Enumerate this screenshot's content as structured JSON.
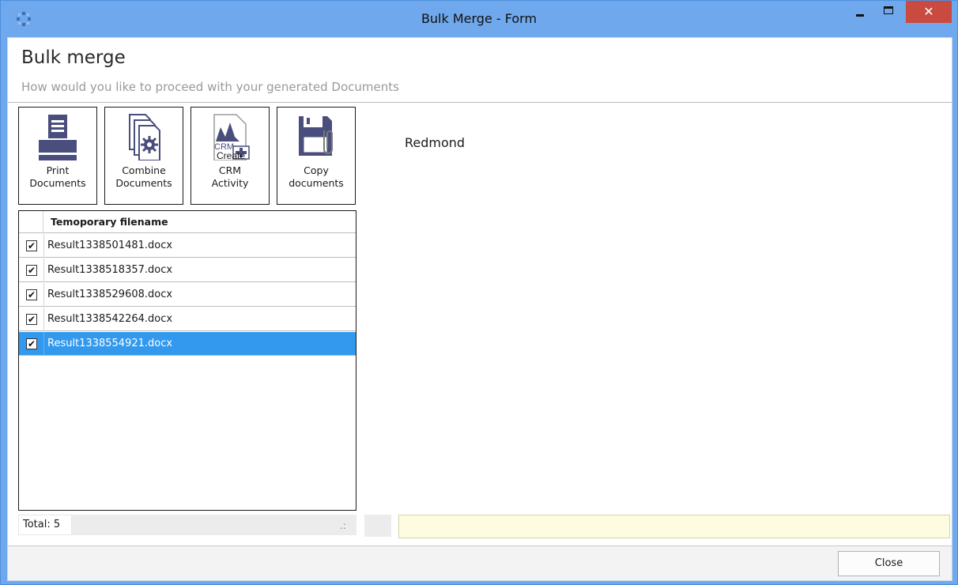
{
  "window": {
    "title": "Bulk Merge - Form",
    "close_glyph": "✕"
  },
  "header": {
    "title": "Bulk merge",
    "subtitle": "How would you like to proceed with your generated Documents"
  },
  "toolbar": [
    {
      "label": "Print\nDocuments",
      "icon": "printer-icon"
    },
    {
      "label": "Combine\nDocuments",
      "icon": "combine-documents-icon"
    },
    {
      "label": "CRM\nActivity",
      "icon": "crm-activity-icon",
      "overlay": "Create",
      "icon_text": "CRM"
    },
    {
      "label": "Copy\ndocuments",
      "icon": "floppy-copy-icon"
    }
  ],
  "grid": {
    "column_header": "Temoporary filename",
    "rows": [
      {
        "filename": "Result1338501481.docx",
        "checked": true,
        "selected": false
      },
      {
        "filename": "Result1338518357.docx",
        "checked": true,
        "selected": false
      },
      {
        "filename": "Result1338529608.docx",
        "checked": true,
        "selected": false
      },
      {
        "filename": "Result1338542264.docx",
        "checked": true,
        "selected": false
      },
      {
        "filename": "Result1338554921.docx",
        "checked": true,
        "selected": true
      }
    ],
    "check_glyph": "✔"
  },
  "status": {
    "total_label": "Total:",
    "total_value": "5"
  },
  "content": {
    "location": "Redmond"
  },
  "footer": {
    "close_label": "Close"
  },
  "colors": {
    "titlebar": "#6fa8ec",
    "close_button": "#c94a3f",
    "selection": "#3399ee",
    "icon_slate": "#4a4e7c",
    "info_field": "#fdfbe0"
  }
}
